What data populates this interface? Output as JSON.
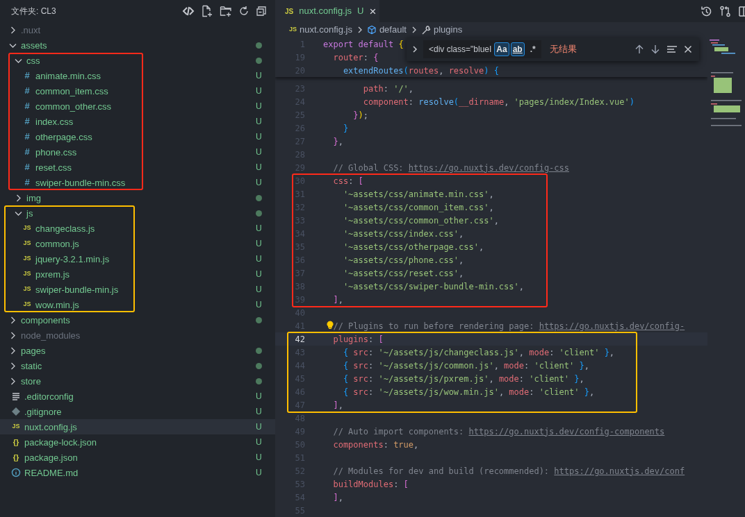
{
  "sidebar": {
    "title": "文件夹: CL3",
    "items": [
      {
        "label": ".nuxt",
        "kind": "folder",
        "expanded": false,
        "selected": false,
        "dot": false,
        "color": "#6b727e"
      },
      {
        "label": "assets",
        "kind": "folder",
        "expanded": true,
        "selected": false,
        "dot": true,
        "color": "#73c991",
        "children": [
          {
            "label": "css",
            "kind": "folder",
            "expanded": true,
            "selected": false,
            "dot": true,
            "color": "#73c991",
            "frame": {
              "color": "#ff2a1a"
            },
            "children": [
              {
                "label": "animate.min.css",
                "kind": "css",
                "glyph": "#",
                "badge": "U",
                "selected": false,
                "color": "#73c991"
              },
              {
                "label": "common_item.css",
                "kind": "css",
                "glyph": "#",
                "badge": "U",
                "selected": false,
                "color": "#73c991"
              },
              {
                "label": "common_other.css",
                "kind": "css",
                "glyph": "#",
                "badge": "U",
                "selected": false,
                "color": "#73c991"
              },
              {
                "label": "index.css",
                "kind": "css",
                "glyph": "#",
                "badge": "U",
                "selected": false,
                "color": "#73c991"
              },
              {
                "label": "otherpage.css",
                "kind": "css",
                "glyph": "#",
                "badge": "U",
                "selected": false,
                "color": "#73c991"
              },
              {
                "label": "phone.css",
                "kind": "css",
                "glyph": "#",
                "badge": "U",
                "selected": false,
                "color": "#73c991"
              },
              {
                "label": "reset.css",
                "kind": "css",
                "glyph": "#",
                "badge": "U",
                "selected": false,
                "color": "#73c991"
              },
              {
                "label": "swiper-bundle-min.css",
                "kind": "css",
                "glyph": "#",
                "badge": "U",
                "selected": false,
                "color": "#73c991"
              }
            ]
          },
          {
            "label": "img",
            "kind": "folder",
            "expanded": false,
            "selected": false,
            "dot": true,
            "color": "#73c991"
          },
          {
            "label": "js",
            "kind": "folder",
            "expanded": true,
            "selected": false,
            "dot": true,
            "color": "#73c991",
            "frame": {
              "color": "#ffbf00"
            },
            "children": [
              {
                "label": "changeclass.js",
                "kind": "js",
                "glyph": "JS",
                "badge": "U",
                "selected": false,
                "color": "#73c991"
              },
              {
                "label": "common.js",
                "kind": "js",
                "glyph": "JS",
                "badge": "U",
                "selected": false,
                "color": "#73c991"
              },
              {
                "label": "jquery-3.2.1.min.js",
                "kind": "js",
                "glyph": "JS",
                "badge": "U",
                "selected": false,
                "color": "#73c991"
              },
              {
                "label": "pxrem.js",
                "kind": "js",
                "glyph": "JS",
                "badge": "U",
                "selected": false,
                "color": "#73c991"
              },
              {
                "label": "swiper-bundle-min.js",
                "kind": "js",
                "glyph": "JS",
                "badge": "U",
                "selected": false,
                "color": "#73c991"
              },
              {
                "label": "wow.min.js",
                "kind": "js",
                "glyph": "JS",
                "badge": "U",
                "selected": false,
                "color": "#73c991"
              }
            ]
          }
        ]
      },
      {
        "label": "components",
        "kind": "folder",
        "expanded": false,
        "selected": false,
        "dot": true,
        "color": "#73c991"
      },
      {
        "label": "node_modules",
        "kind": "folder",
        "expanded": false,
        "selected": false,
        "dot": false,
        "color": "#6b727e"
      },
      {
        "label": "pages",
        "kind": "folder",
        "expanded": false,
        "selected": false,
        "dot": true,
        "color": "#73c991"
      },
      {
        "label": "static",
        "kind": "folder",
        "expanded": false,
        "selected": false,
        "dot": true,
        "color": "#73c991"
      },
      {
        "label": "store",
        "kind": "folder",
        "expanded": false,
        "selected": false,
        "dot": true,
        "color": "#73c991"
      },
      {
        "label": ".editorconfig",
        "kind": "config",
        "badge": "U",
        "selected": false,
        "color": "#73c991"
      },
      {
        "label": ".gitignore",
        "kind": "git",
        "badge": "U",
        "selected": false,
        "color": "#73c991"
      },
      {
        "label": "nuxt.config.js",
        "kind": "js",
        "glyph": "JS",
        "badge": "U",
        "selected": true,
        "color": "#73c991"
      },
      {
        "label": "package-lock.json",
        "kind": "json",
        "glyph": "{}",
        "badge": "U",
        "selected": false,
        "color": "#73c991"
      },
      {
        "label": "package.json",
        "kind": "json",
        "glyph": "{}",
        "badge": "U",
        "selected": false,
        "color": "#73c991"
      },
      {
        "label": "README.md",
        "kind": "md",
        "badge": "U",
        "selected": false,
        "color": "#73c991"
      }
    ]
  },
  "tab": {
    "glyph": "JS",
    "label": "nuxt.config.js",
    "badge": "U",
    "close": "×",
    "selected": true
  },
  "breadcrumb": [
    {
      "kind": "js",
      "glyph": "JS",
      "label": "nuxt.config.js"
    },
    {
      "kind": "module",
      "label": "default"
    },
    {
      "kind": "property",
      "label": "plugins"
    }
  ],
  "find": {
    "value": "<div class=\"blueI",
    "toggles": [
      {
        "label": "Aa",
        "selected": true
      },
      {
        "label": "ab",
        "selected": true
      },
      {
        "label": ".*",
        "selected": false
      }
    ],
    "result": "无结果"
  },
  "sticky_lines": [
    {
      "number": "1",
      "tokens": [
        {
          "kind": "kw",
          "text": "export default "
        },
        {
          "kind": "b1",
          "text": "{"
        }
      ]
    },
    {
      "number": "19",
      "tokens": [
        {
          "kind": "prop",
          "text": "  router"
        },
        {
          "kind": "punc",
          "text": ": "
        },
        {
          "kind": "b2",
          "text": "{"
        }
      ]
    },
    {
      "number": "20",
      "tokens": [
        {
          "kind": "fn",
          "text": "    extendRoutes"
        },
        {
          "kind": "b3",
          "text": "("
        },
        {
          "kind": "prop",
          "text": "routes"
        },
        {
          "kind": "punc",
          "text": ", "
        },
        {
          "kind": "prop",
          "text": "resolve"
        },
        {
          "kind": "b3",
          "text": ") {"
        }
      ]
    }
  ],
  "code": [
    {
      "number": "23",
      "tokens": [
        {
          "kind": "prop",
          "text": "        path"
        },
        {
          "kind": "punc",
          "text": ": "
        },
        {
          "kind": "str",
          "text": "'/'"
        },
        {
          "kind": "punc",
          "text": ","
        }
      ]
    },
    {
      "number": "24",
      "tokens": [
        {
          "kind": "prop",
          "text": "        component"
        },
        {
          "kind": "punc",
          "text": ": "
        },
        {
          "kind": "fn",
          "text": "resolve"
        },
        {
          "kind": "b3",
          "text": "("
        },
        {
          "kind": "prop",
          "text": "__dirname"
        },
        {
          "kind": "punc",
          "text": ", "
        },
        {
          "kind": "str",
          "text": "'pages/index/Index.vue'"
        },
        {
          "kind": "b3",
          "text": ")"
        }
      ]
    },
    {
      "number": "25",
      "tokens": [
        {
          "kind": "b2",
          "text": "      }"
        },
        {
          "kind": "b1",
          "text": ")"
        },
        {
          "kind": "punc",
          "text": ";"
        }
      ]
    },
    {
      "number": "26",
      "tokens": [
        {
          "kind": "b3",
          "text": "    }"
        }
      ]
    },
    {
      "number": "27",
      "tokens": [
        {
          "kind": "b2",
          "text": "  }"
        },
        {
          "kind": "punc",
          "text": ","
        }
      ]
    },
    {
      "number": "28"
    },
    {
      "number": "29",
      "tokens": [
        {
          "kind": "comment",
          "text": "  // Global CSS: "
        },
        {
          "kind": "link",
          "text": "https://go.nuxtjs.dev/config-css"
        }
      ]
    },
    {
      "frame": {
        "color": "#ff2a1a"
      },
      "lines": [
        {
          "number": "30",
          "tokens": [
            {
              "kind": "prop",
              "text": "  css"
            },
            {
              "kind": "punc",
              "text": ": "
            },
            {
              "kind": "b2",
              "text": "["
            }
          ]
        },
        {
          "number": "31",
          "tokens": [
            {
              "kind": "str",
              "text": "    '~assets/css/animate.min.css'"
            },
            {
              "kind": "punc",
              "text": ","
            }
          ]
        },
        {
          "number": "32",
          "tokens": [
            {
              "kind": "str",
              "text": "    '~assets/css/common_item.css'"
            },
            {
              "kind": "punc",
              "text": ","
            }
          ]
        },
        {
          "number": "33",
          "tokens": [
            {
              "kind": "str",
              "text": "    '~assets/css/common_other.css'"
            },
            {
              "kind": "punc",
              "text": ","
            }
          ]
        },
        {
          "number": "34",
          "tokens": [
            {
              "kind": "str",
              "text": "    '~assets/css/index.css'"
            },
            {
              "kind": "punc",
              "text": ","
            }
          ]
        },
        {
          "number": "35",
          "tokens": [
            {
              "kind": "str",
              "text": "    '~assets/css/otherpage.css'"
            },
            {
              "kind": "punc",
              "text": ","
            }
          ]
        },
        {
          "number": "36",
          "tokens": [
            {
              "kind": "str",
              "text": "    '~assets/css/phone.css'"
            },
            {
              "kind": "punc",
              "text": ","
            }
          ]
        },
        {
          "number": "37",
          "tokens": [
            {
              "kind": "str",
              "text": "    '~assets/css/reset.css'"
            },
            {
              "kind": "punc",
              "text": ","
            }
          ]
        },
        {
          "number": "38",
          "tokens": [
            {
              "kind": "str",
              "text": "    '~assets/css/swiper-bundle-min.css'"
            },
            {
              "kind": "punc",
              "text": ","
            }
          ]
        },
        {
          "number": "39",
          "tokens": [
            {
              "kind": "b2",
              "text": "  ]"
            },
            {
              "kind": "punc",
              "text": ","
            }
          ]
        }
      ]
    },
    {
      "number": "40"
    },
    {
      "number": "41",
      "lightbulb": true,
      "tokens": [
        {
          "kind": "comment",
          "text": "  // Plugins to run before rendering page: "
        },
        {
          "kind": "link",
          "text": "https://go.nuxtjs.dev/config-"
        }
      ]
    },
    {
      "frame": {
        "color": "#ffbf00"
      },
      "lines": [
        {
          "number": "42",
          "current": true,
          "tokens": [
            {
              "kind": "prop",
              "text": "  plugins"
            },
            {
              "kind": "punc",
              "text": ": "
            },
            {
              "kind": "b2",
              "text": "["
            }
          ]
        },
        {
          "number": "43",
          "tokens": [
            {
              "kind": "b3",
              "text": "    { "
            },
            {
              "kind": "prop",
              "text": "src"
            },
            {
              "kind": "punc",
              "text": ": "
            },
            {
              "kind": "str",
              "text": "'~/assets/js/changeclass.js'"
            },
            {
              "kind": "punc",
              "text": ", "
            },
            {
              "kind": "prop",
              "text": "mode"
            },
            {
              "kind": "punc",
              "text": ": "
            },
            {
              "kind": "str",
              "text": "'client' "
            },
            {
              "kind": "b3",
              "text": "}"
            },
            {
              "kind": "punc",
              "text": ","
            }
          ]
        },
        {
          "number": "44",
          "tokens": [
            {
              "kind": "b3",
              "text": "    { "
            },
            {
              "kind": "prop",
              "text": "src"
            },
            {
              "kind": "punc",
              "text": ": "
            },
            {
              "kind": "str",
              "text": "'~/assets/js/common.js'"
            },
            {
              "kind": "punc",
              "text": ", "
            },
            {
              "kind": "prop",
              "text": "mode"
            },
            {
              "kind": "punc",
              "text": ": "
            },
            {
              "kind": "str",
              "text": "'client' "
            },
            {
              "kind": "b3",
              "text": "}"
            },
            {
              "kind": "punc",
              "text": ","
            }
          ]
        },
        {
          "number": "45",
          "tokens": [
            {
              "kind": "b3",
              "text": "    { "
            },
            {
              "kind": "prop",
              "text": "src"
            },
            {
              "kind": "punc",
              "text": ": "
            },
            {
              "kind": "str",
              "text": "'~/assets/js/pxrem.js'"
            },
            {
              "kind": "punc",
              "text": ", "
            },
            {
              "kind": "prop",
              "text": "mode"
            },
            {
              "kind": "punc",
              "text": ": "
            },
            {
              "kind": "str",
              "text": "'client' "
            },
            {
              "kind": "b3",
              "text": "}"
            },
            {
              "kind": "punc",
              "text": ","
            }
          ]
        },
        {
          "number": "46",
          "tokens": [
            {
              "kind": "b3",
              "text": "    { "
            },
            {
              "kind": "prop",
              "text": "src"
            },
            {
              "kind": "punc",
              "text": ": "
            },
            {
              "kind": "str",
              "text": "'~/assets/js/wow.min.js'"
            },
            {
              "kind": "punc",
              "text": ", "
            },
            {
              "kind": "prop",
              "text": "mode"
            },
            {
              "kind": "punc",
              "text": ": "
            },
            {
              "kind": "str",
              "text": "'client' "
            },
            {
              "kind": "b3",
              "text": "}"
            },
            {
              "kind": "punc",
              "text": ","
            }
          ]
        },
        {
          "number": "47",
          "tokens": [
            {
              "kind": "b2",
              "text": "  ]"
            },
            {
              "kind": "punc",
              "text": ","
            }
          ]
        }
      ]
    },
    {
      "number": "48"
    },
    {
      "number": "49",
      "tokens": [
        {
          "kind": "comment",
          "text": "  // Auto import components: "
        },
        {
          "kind": "link",
          "text": "https://go.nuxtjs.dev/config-components"
        }
      ]
    },
    {
      "number": "50",
      "tokens": [
        {
          "kind": "prop",
          "text": "  components"
        },
        {
          "kind": "punc",
          "text": ": "
        },
        {
          "kind": "bool",
          "text": "true"
        },
        {
          "kind": "punc",
          "text": ","
        }
      ]
    },
    {
      "number": "51"
    },
    {
      "number": "52",
      "tokens": [
        {
          "kind": "comment",
          "text": "  // Modules for dev and build (recommended): "
        },
        {
          "kind": "link",
          "text": "https://go.nuxtjs.dev/conf"
        }
      ]
    },
    {
      "number": "53",
      "tokens": [
        {
          "kind": "prop",
          "text": "  buildModules"
        },
        {
          "kind": "punc",
          "text": ": "
        },
        {
          "kind": "b2",
          "text": "["
        }
      ]
    },
    {
      "number": "54",
      "tokens": [
        {
          "kind": "b2",
          "text": "  ]"
        },
        {
          "kind": "punc",
          "text": ","
        }
      ]
    },
    {
      "number": "55"
    }
  ]
}
